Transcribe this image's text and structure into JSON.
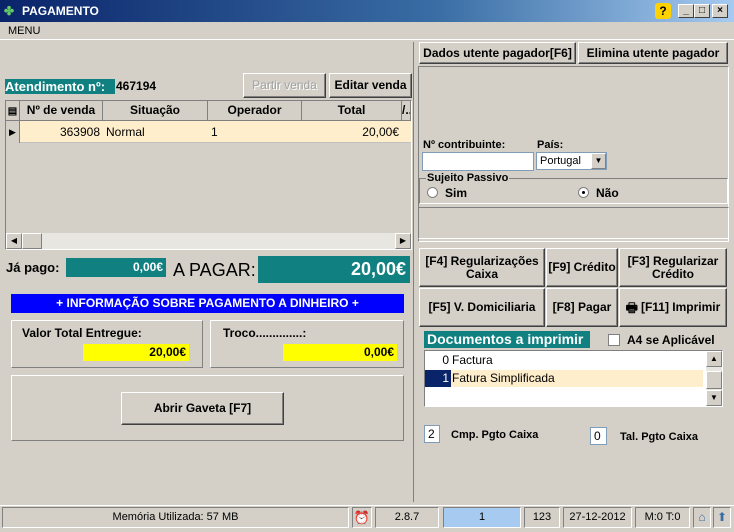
{
  "window": {
    "title": "PAGAMENTO"
  },
  "menu": {
    "label": "MENU"
  },
  "right_top": {
    "btn_utente": "Dados utente pagador[F6]",
    "btn_elimina": "Elimina utente pagador"
  },
  "atendimento": {
    "label": "Atendimento nº:",
    "value": "467194",
    "btn_partir": "Partir venda",
    "btn_editar": "Editar venda"
  },
  "grid": {
    "headers": [
      "Nº de venda",
      "Situação",
      "Operador",
      "Total",
      "/..."
    ],
    "rows": [
      {
        "num": "363908",
        "situacao": "Normal",
        "operador": "1",
        "total": "20,00€"
      }
    ]
  },
  "pago": {
    "ja_pago_label": "Já pago:",
    "ja_pago_value": "0,00€",
    "a_pagar_label": "A PAGAR:",
    "a_pagar_value": "20,00€"
  },
  "info": {
    "banner": "+ INFORMAÇÃO SOBRE PAGAMENTO A DINHEIRO +",
    "valor_label": "Valor Total Entregue:",
    "valor_value": "20,00€",
    "troco_label": "Troco..............:",
    "troco_value": "0,00€",
    "abrir_gaveta": "Abrir Gaveta [F7]"
  },
  "cliente": {
    "nif_label": "Nº contribuinte:",
    "nif_value": "",
    "pais_label": "País:",
    "pais_value": "Portugal",
    "sujeito_label": "Sujeito Passivo",
    "sim": "Sim",
    "nao": "Não"
  },
  "actions": {
    "f4": "[F4] Regularizações Caixa",
    "f9": "[F9] Crédito",
    "f3": "[F3] Regularizar Crédito",
    "f5": "[F5] V. Domiciliaria",
    "f8": "[F8] Pagar",
    "f11": "[F11] Imprimir"
  },
  "docs": {
    "title": "Documentos a imprimir",
    "a4_label": "A4 se Aplicável",
    "items": [
      {
        "qty": "0",
        "name": "Factura"
      },
      {
        "qty": "1",
        "name": "Fatura Simplificada"
      }
    ],
    "cmp_value": "2",
    "cmp_label": "Cmp. Pgto Caixa",
    "tal_value": "0",
    "tal_label": "Tal. Pgto Caixa"
  },
  "status": {
    "memoria": "Memória Utilizada: 57 MB",
    "version": "2.8.7",
    "user": "1",
    "code": "123",
    "date": "27-12-2012",
    "mt": "M:0 T:0"
  },
  "colors": {
    "teal": "#108080",
    "yellow": "#ffff00",
    "blue_banner": "#0000ff",
    "row_highlight": "#ffeecc"
  }
}
